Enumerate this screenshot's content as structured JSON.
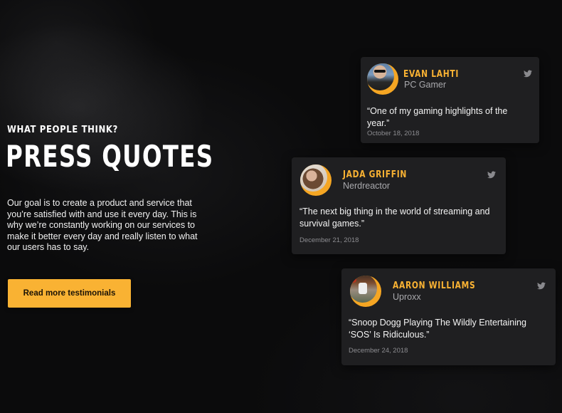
{
  "section": {
    "subtitle": "WHAT PEOPLE THINK?",
    "title": "PRESS QUOTES",
    "description": "Our goal is to create a product and service that you’re satisfied with and use it every day. This is why we’re constantly working on our services to make it better every day and really listen to what our users has to say.",
    "cta_label": "Read more testimonials"
  },
  "testimonials": [
    {
      "name": "EVAN LAHTI",
      "source": "PC Gamer",
      "quote": "“One of my gaming highlights of the year.”",
      "date": "October 18, 2018",
      "icon": "twitter-icon"
    },
    {
      "name": "JADA GRIFFIN",
      "source": "Nerdreactor",
      "quote": "“The next big thing in the world of streaming and survival games.”",
      "date": "December 21, 2018",
      "icon": "twitter-icon"
    },
    {
      "name": "AARON WILLIAMS",
      "source": "Uproxx",
      "quote": "“Snoop Dogg Playing The Wildly Entertaining ‘SOS’ Is Ridiculous.”",
      "date": "December 24, 2018",
      "icon": "twitter-icon"
    }
  ],
  "colors": {
    "accent": "#f9b233",
    "card": "#1f1f21",
    "background": "#0b0b0c"
  }
}
